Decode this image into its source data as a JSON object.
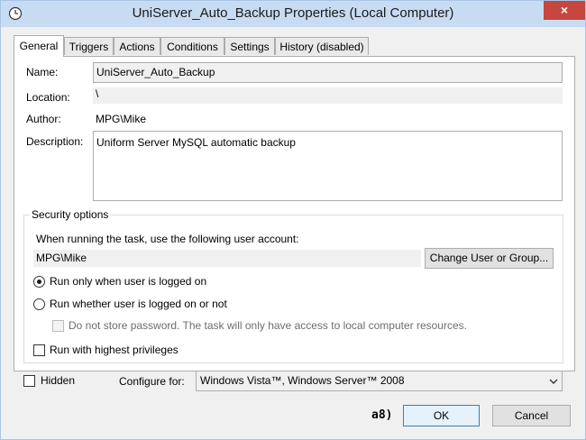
{
  "window": {
    "title": "UniServer_Auto_Backup Properties (Local Computer)",
    "close_glyph": "×"
  },
  "tabs": [
    {
      "label": "General",
      "active": true
    },
    {
      "label": "Triggers"
    },
    {
      "label": "Actions"
    },
    {
      "label": "Conditions"
    },
    {
      "label": "Settings"
    },
    {
      "label": "History (disabled)"
    }
  ],
  "general": {
    "name_label": "Name:",
    "name_value": "UniServer_Auto_Backup",
    "location_label": "Location:",
    "location_value": "\\",
    "author_label": "Author:",
    "author_value": "MPG\\Mike",
    "description_label": "Description:",
    "description_value": "Uniform Server MySQL automatic backup"
  },
  "security": {
    "title": "Security options",
    "account_prompt": "When running the task, use the following user account:",
    "account_value": "MPG\\Mike",
    "change_button": "Change User or Group...",
    "radio_logged_on": "Run only when user is logged on",
    "radio_whether": "Run whether user is logged on or not",
    "no_store_password": "Do not store password.  The task will only have access to local computer resources.",
    "highest_privileges": "Run with highest privileges"
  },
  "bottom": {
    "hidden_label": "Hidden",
    "configure_label": "Configure for:",
    "configure_value": "Windows Vista™, Windows Server™ 2008"
  },
  "footer": {
    "annotation": "a8)",
    "ok_button": "OK",
    "cancel_button": "Cancel"
  },
  "icons": {
    "title_icon": "clock-icon",
    "dropdown_icon": "chevron-down-icon"
  }
}
